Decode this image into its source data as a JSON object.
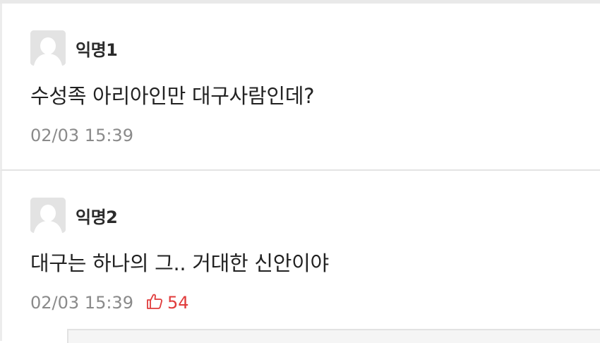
{
  "comments": [
    {
      "author": "익명1",
      "text": "수성족 아리아인만 대구사람인데?",
      "date": "02/03 15:39",
      "likes": null
    },
    {
      "author": "익명2",
      "text": "대구는 하나의 그.. 거대한 신안이야",
      "date": "02/03 15:39",
      "likes": "54"
    }
  ],
  "colors": {
    "like": "#e03b3b",
    "date": "#8a8a8a",
    "avatar_bg": "#e3e3e3"
  },
  "icons": {
    "avatar": "default-user-avatar-icon",
    "like": "thumbs-up-icon"
  }
}
